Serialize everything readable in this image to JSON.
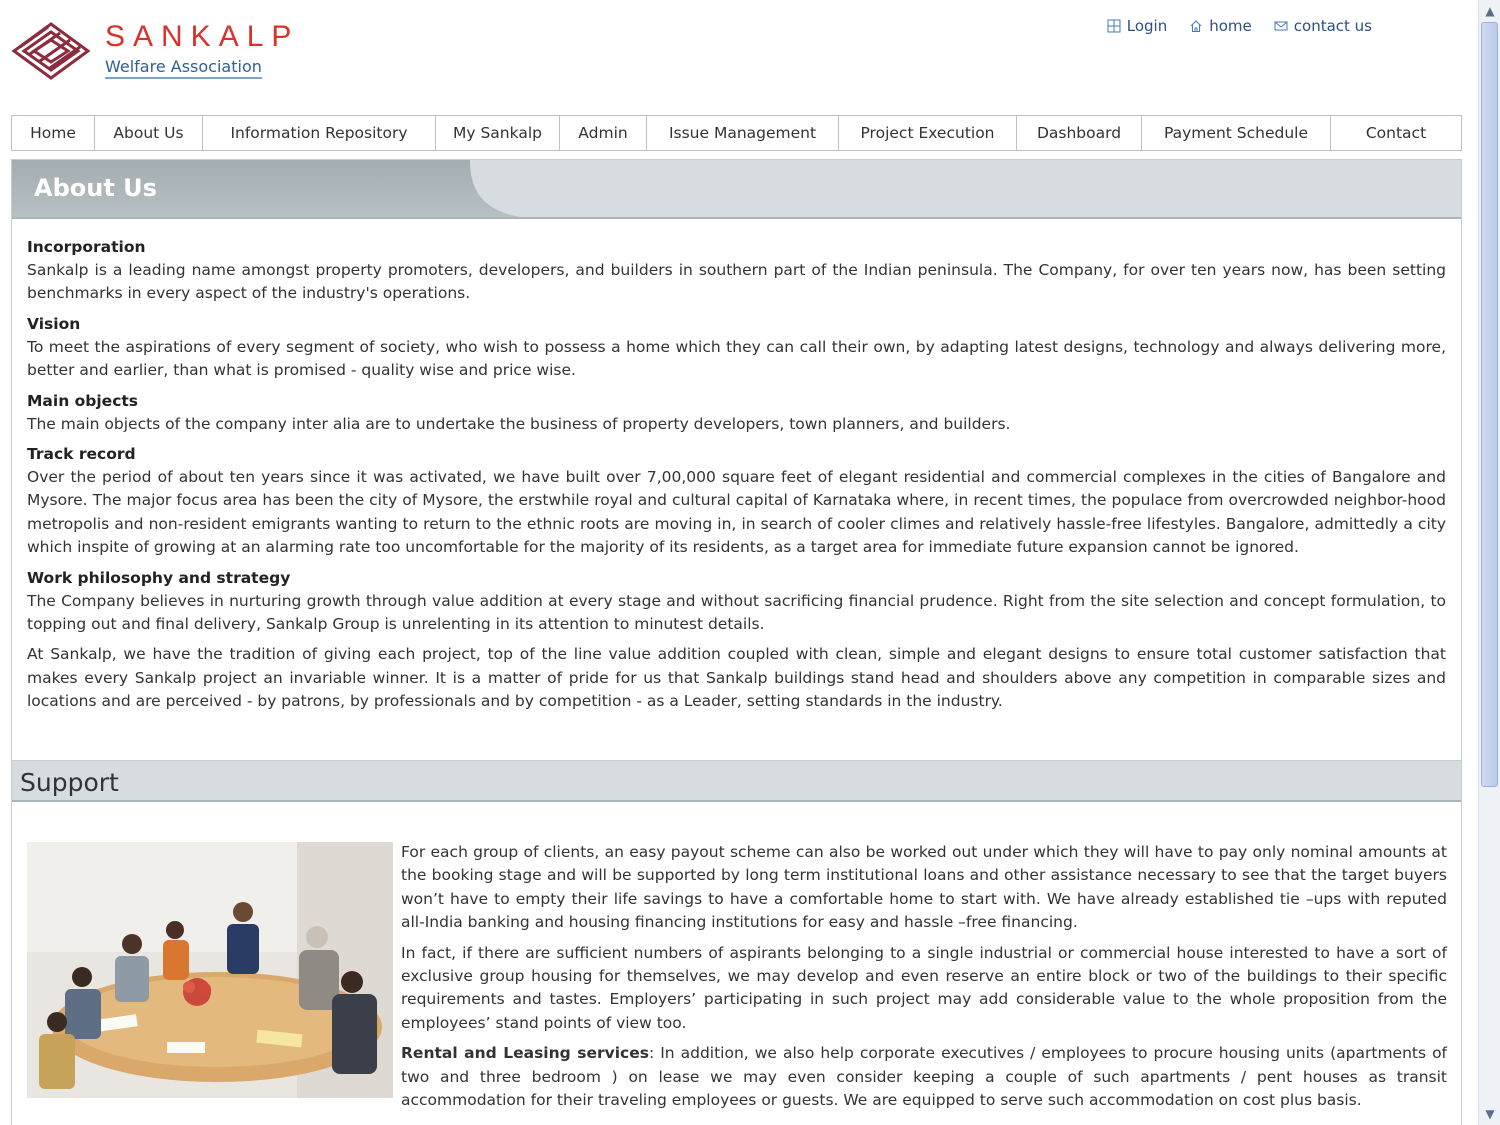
{
  "logo": {
    "name": "SANKALP",
    "subtitle": "Welfare Association"
  },
  "top_links": [
    {
      "label": "Login",
      "icon": "grid-icon"
    },
    {
      "label": "home",
      "icon": "home-icon"
    },
    {
      "label": "contact us",
      "icon": "envelope-icon"
    }
  ],
  "nav": [
    "Home",
    "About Us",
    "Information Repository",
    "My Sankalp",
    "Admin",
    "Issue Management",
    "Project Execution",
    "Dashboard",
    "Payment Schedule",
    "Contact"
  ],
  "about": {
    "title": "About Us",
    "sections": [
      {
        "heading": "Incorporation",
        "text": "Sankalp is a leading name amongst property promoters, developers, and builders in southern part of the Indian peninsula. The Company, for over ten years now, has been setting benchmarks in every aspect of the industry's operations."
      },
      {
        "heading": "Vision",
        "text": "To meet the aspirations of every segment of society, who wish to possess a home which they can call their own, by adapting latest designs, technology and always delivering more, better and earlier, than what is promised - quality wise and price wise."
      },
      {
        "heading": "Main objects",
        "text": "The main objects of the company inter alia are to undertake the business of property developers, town planners, and builders."
      },
      {
        "heading": "Track record",
        "text": "Over the period of about ten years since it was activated, we have built over 7,00,000 square feet of elegant residential and commercial complexes in the cities of Bangalore and Mysore. The major focus area has been the city of Mysore, the erstwhile royal and cultural capital of Karnataka where, in recent times, the populace from overcrowded neighbor-hood metropolis and non-resident emigrants wanting to return to the ethnic roots are moving in, in search of cooler climes and relatively hassle-free lifestyles. Bangalore, admittedly a city which inspite of growing at an alarming rate too uncomfortable for the majority of its residents, as a target area for immediate future expansion cannot be ignored."
      },
      {
        "heading": "Work philosophy and strategy",
        "text": "The Company believes in nurturing growth through value addition at every stage and without sacrificing financial prudence. Right from the site selection and concept formulation, to topping out and final delivery, Sankalp Group is unrelenting in its attention to minutest details."
      }
    ],
    "closing": "At Sankalp, we have the tradition of giving each project, top of the line value addition coupled with clean, simple and elegant designs to ensure total customer satisfaction that makes every Sankalp project an invariable winner. It is a matter of pride for us that Sankalp buildings stand head and shoulders above any competition in comparable sizes and locations and are perceived - by patrons, by professionals and by competition - as a Leader, setting standards in the industry."
  },
  "support": {
    "title": "Support",
    "para1": "For each group of clients, an easy payout scheme can also be worked out under which they will have to pay only nominal amounts at the booking stage and will be supported by long term institutional loans and other assistance necessary to see that the target buyers won’t have to empty their life savings to have a comfortable home to start with. We have already established tie –ups with reputed all-India banking and housing financing institutions for easy and hassle –free financing.",
    "para2": "In fact, if there are sufficient numbers of aspirants belonging to a single industrial or commercial house interested to have a sort of exclusive group housing for themselves, we may develop and even reserve an entire block or two of the buildings to their specific requirements and tastes. Employers’ participating in such project may add considerable value to the whole proposition from the employees’ stand points of view too.",
    "rental_label": "Rental and Leasing services",
    "rental_text": ": In addition, we also help corporate executives / employees to procure housing units (apartments of two and three bedroom ) on lease we may even consider keeping a couple of such apartments / pent houses as transit accommodation for their traveling employees or guests. We are equipped to serve such accommodation on cost plus basis."
  },
  "colors": {
    "brand_red": "#d8322b",
    "brand_blue": "#2f5f9a",
    "header_gray": "#a7b1b4"
  }
}
